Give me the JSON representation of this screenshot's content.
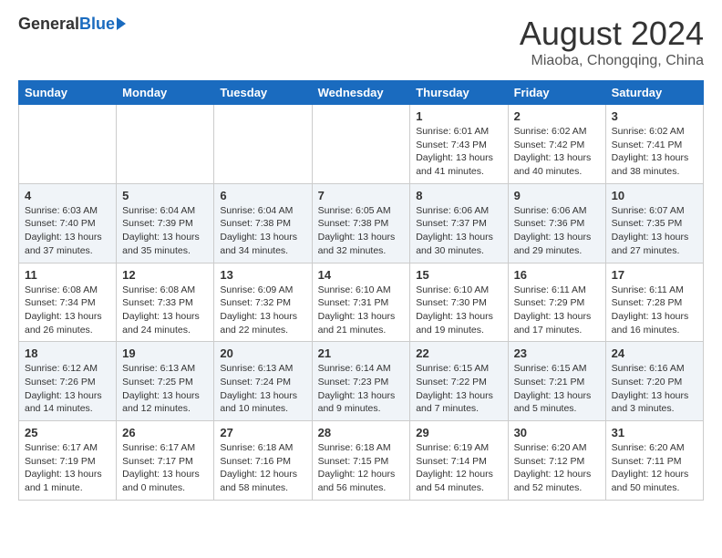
{
  "header": {
    "logo_general": "General",
    "logo_blue": "Blue",
    "month_year": "August 2024",
    "location": "Miaoba, Chongqing, China"
  },
  "days_of_week": [
    "Sunday",
    "Monday",
    "Tuesday",
    "Wednesday",
    "Thursday",
    "Friday",
    "Saturday"
  ],
  "weeks": [
    [
      {
        "num": "",
        "info": ""
      },
      {
        "num": "",
        "info": ""
      },
      {
        "num": "",
        "info": ""
      },
      {
        "num": "",
        "info": ""
      },
      {
        "num": "1",
        "info": "Sunrise: 6:01 AM\nSunset: 7:43 PM\nDaylight: 13 hours\nand 41 minutes."
      },
      {
        "num": "2",
        "info": "Sunrise: 6:02 AM\nSunset: 7:42 PM\nDaylight: 13 hours\nand 40 minutes."
      },
      {
        "num": "3",
        "info": "Sunrise: 6:02 AM\nSunset: 7:41 PM\nDaylight: 13 hours\nand 38 minutes."
      }
    ],
    [
      {
        "num": "4",
        "info": "Sunrise: 6:03 AM\nSunset: 7:40 PM\nDaylight: 13 hours\nand 37 minutes."
      },
      {
        "num": "5",
        "info": "Sunrise: 6:04 AM\nSunset: 7:39 PM\nDaylight: 13 hours\nand 35 minutes."
      },
      {
        "num": "6",
        "info": "Sunrise: 6:04 AM\nSunset: 7:38 PM\nDaylight: 13 hours\nand 34 minutes."
      },
      {
        "num": "7",
        "info": "Sunrise: 6:05 AM\nSunset: 7:38 PM\nDaylight: 13 hours\nand 32 minutes."
      },
      {
        "num": "8",
        "info": "Sunrise: 6:06 AM\nSunset: 7:37 PM\nDaylight: 13 hours\nand 30 minutes."
      },
      {
        "num": "9",
        "info": "Sunrise: 6:06 AM\nSunset: 7:36 PM\nDaylight: 13 hours\nand 29 minutes."
      },
      {
        "num": "10",
        "info": "Sunrise: 6:07 AM\nSunset: 7:35 PM\nDaylight: 13 hours\nand 27 minutes."
      }
    ],
    [
      {
        "num": "11",
        "info": "Sunrise: 6:08 AM\nSunset: 7:34 PM\nDaylight: 13 hours\nand 26 minutes."
      },
      {
        "num": "12",
        "info": "Sunrise: 6:08 AM\nSunset: 7:33 PM\nDaylight: 13 hours\nand 24 minutes."
      },
      {
        "num": "13",
        "info": "Sunrise: 6:09 AM\nSunset: 7:32 PM\nDaylight: 13 hours\nand 22 minutes."
      },
      {
        "num": "14",
        "info": "Sunrise: 6:10 AM\nSunset: 7:31 PM\nDaylight: 13 hours\nand 21 minutes."
      },
      {
        "num": "15",
        "info": "Sunrise: 6:10 AM\nSunset: 7:30 PM\nDaylight: 13 hours\nand 19 minutes."
      },
      {
        "num": "16",
        "info": "Sunrise: 6:11 AM\nSunset: 7:29 PM\nDaylight: 13 hours\nand 17 minutes."
      },
      {
        "num": "17",
        "info": "Sunrise: 6:11 AM\nSunset: 7:28 PM\nDaylight: 13 hours\nand 16 minutes."
      }
    ],
    [
      {
        "num": "18",
        "info": "Sunrise: 6:12 AM\nSunset: 7:26 PM\nDaylight: 13 hours\nand 14 minutes."
      },
      {
        "num": "19",
        "info": "Sunrise: 6:13 AM\nSunset: 7:25 PM\nDaylight: 13 hours\nand 12 minutes."
      },
      {
        "num": "20",
        "info": "Sunrise: 6:13 AM\nSunset: 7:24 PM\nDaylight: 13 hours\nand 10 minutes."
      },
      {
        "num": "21",
        "info": "Sunrise: 6:14 AM\nSunset: 7:23 PM\nDaylight: 13 hours\nand 9 minutes."
      },
      {
        "num": "22",
        "info": "Sunrise: 6:15 AM\nSunset: 7:22 PM\nDaylight: 13 hours\nand 7 minutes."
      },
      {
        "num": "23",
        "info": "Sunrise: 6:15 AM\nSunset: 7:21 PM\nDaylight: 13 hours\nand 5 minutes."
      },
      {
        "num": "24",
        "info": "Sunrise: 6:16 AM\nSunset: 7:20 PM\nDaylight: 13 hours\nand 3 minutes."
      }
    ],
    [
      {
        "num": "25",
        "info": "Sunrise: 6:17 AM\nSunset: 7:19 PM\nDaylight: 13 hours\nand 1 minute."
      },
      {
        "num": "26",
        "info": "Sunrise: 6:17 AM\nSunset: 7:17 PM\nDaylight: 13 hours\nand 0 minutes."
      },
      {
        "num": "27",
        "info": "Sunrise: 6:18 AM\nSunset: 7:16 PM\nDaylight: 12 hours\nand 58 minutes."
      },
      {
        "num": "28",
        "info": "Sunrise: 6:18 AM\nSunset: 7:15 PM\nDaylight: 12 hours\nand 56 minutes."
      },
      {
        "num": "29",
        "info": "Sunrise: 6:19 AM\nSunset: 7:14 PM\nDaylight: 12 hours\nand 54 minutes."
      },
      {
        "num": "30",
        "info": "Sunrise: 6:20 AM\nSunset: 7:12 PM\nDaylight: 12 hours\nand 52 minutes."
      },
      {
        "num": "31",
        "info": "Sunrise: 6:20 AM\nSunset: 7:11 PM\nDaylight: 12 hours\nand 50 minutes."
      }
    ]
  ]
}
